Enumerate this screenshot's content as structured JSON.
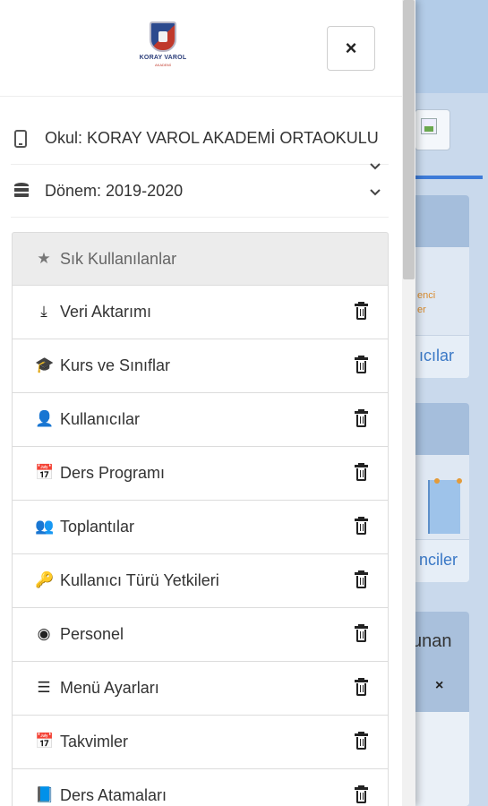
{
  "drawer": {
    "logo_text": "KORAY VAROL",
    "logo_subtext": "AKADEMİ",
    "close_label": "×",
    "school_label": "Okul: KORAY VAROL AKADEMİ ORTAOKULU",
    "period_label": "Dönem: 2019-2020",
    "menu": [
      {
        "label": "Sık Kullanılanlar",
        "icon": "star-icon",
        "glyph": "★"
      },
      {
        "label": "Veri Aktarımı",
        "icon": "download-icon",
        "glyph": "⤓"
      },
      {
        "label": "Kurs ve Sınıflar",
        "icon": "graduation-cap-icon",
        "glyph": "🎓"
      },
      {
        "label": "Kullanıcılar",
        "icon": "user-icon",
        "glyph": "👤"
      },
      {
        "label": "Ders Programı",
        "icon": "calendar-icon",
        "glyph": "📅"
      },
      {
        "label": "Toplantılar",
        "icon": "users-icon",
        "glyph": "👥"
      },
      {
        "label": "Kullanıcı Türü Yetkileri",
        "icon": "key-icon",
        "glyph": "🔑"
      },
      {
        "label": "Personel",
        "icon": "user-circle-icon",
        "glyph": "◉"
      },
      {
        "label": "Menü Ayarları",
        "icon": "list-icon",
        "glyph": "☰"
      },
      {
        "label": "Takvimler",
        "icon": "calendar-icon",
        "glyph": "📅"
      },
      {
        "label": "Ders Atamaları",
        "icon": "book-icon",
        "glyph": "📘"
      }
    ]
  },
  "background": {
    "card1_footer": "ıcılar",
    "card1_tiny_line1": "enci",
    "card1_tiny_line2": "er",
    "card2_footer": "nciler",
    "card3_title": "unan",
    "card3_close": "×"
  }
}
